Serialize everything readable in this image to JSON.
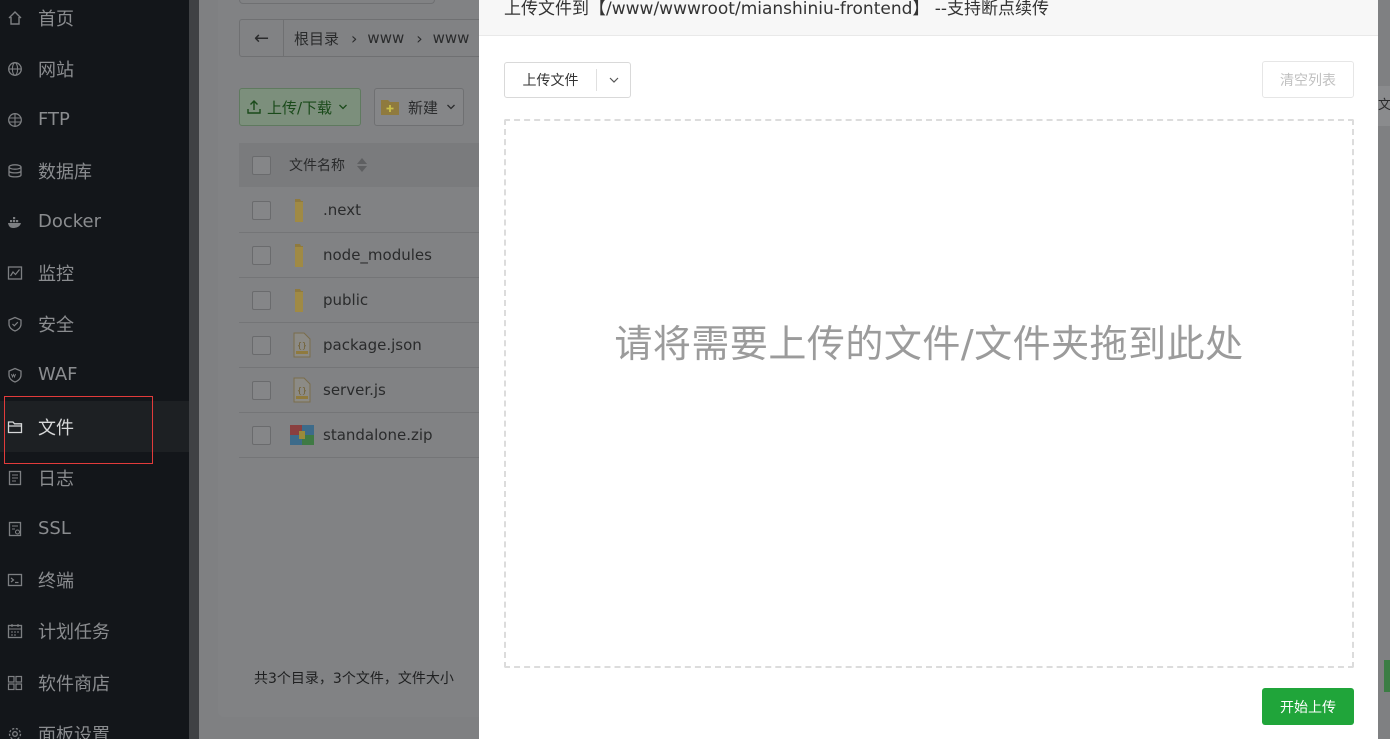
{
  "sidebar": {
    "items": [
      {
        "label": "首页",
        "icon": "home-icon"
      },
      {
        "label": "网站",
        "icon": "globe-icon"
      },
      {
        "label": "FTP",
        "icon": "ftp-icon"
      },
      {
        "label": "数据库",
        "icon": "database-icon"
      },
      {
        "label": "Docker",
        "icon": "docker-icon"
      },
      {
        "label": "监控",
        "icon": "monitor-icon"
      },
      {
        "label": "安全",
        "icon": "shield-icon"
      },
      {
        "label": "WAF",
        "icon": "waf-icon"
      },
      {
        "label": "文件",
        "icon": "folder-icon",
        "active": true
      },
      {
        "label": "日志",
        "icon": "log-icon"
      },
      {
        "label": "SSL",
        "icon": "ssl-icon"
      },
      {
        "label": "终端",
        "icon": "terminal-icon"
      },
      {
        "label": "计划任务",
        "icon": "calendar-icon"
      },
      {
        "label": "软件商店",
        "icon": "store-icon"
      },
      {
        "label": "面板设置",
        "icon": "settings-icon"
      }
    ]
  },
  "file_manager": {
    "path": [
      "根目录",
      "www",
      "www"
    ],
    "upload_button": "上传/下载",
    "new_button": "新建",
    "column_name": "文件名称",
    "files": [
      {
        "name": ".next",
        "type": "folder"
      },
      {
        "name": "node_modules",
        "type": "folder"
      },
      {
        "name": "public",
        "type": "folder"
      },
      {
        "name": "package.json",
        "type": "json"
      },
      {
        "name": "server.js",
        "type": "js"
      },
      {
        "name": "standalone.zip",
        "type": "zip"
      }
    ],
    "footer": "共3个目录，3个文件，文件大小",
    "edge_text": "文"
  },
  "upload_modal": {
    "title": "上传文件到【/www/wwwroot/mianshiniu-frontend】 --支持断点续传",
    "select_label": "上传文件",
    "clear_label": "清空列表",
    "drop_hint": "请将需要上传的文件/文件夹拖到此处",
    "start_label": "开始上传"
  },
  "colors": {
    "accent_green": "#20a53a",
    "sidebar_bg": "#13161a",
    "highlight_red": "#e23b3b"
  }
}
